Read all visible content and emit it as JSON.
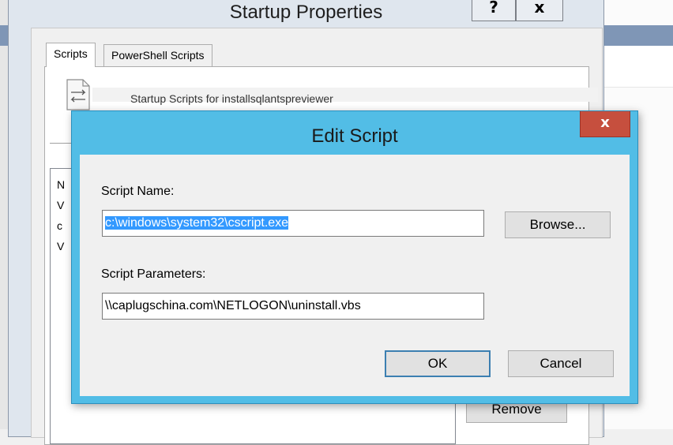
{
  "parent_window": {
    "title": "Startup Properties",
    "help_label": "?",
    "close_label": "x",
    "tabs": [
      {
        "label": "Scripts",
        "active": true
      },
      {
        "label": "PowerShell Scripts",
        "active": false
      }
    ],
    "description": "Startup Scripts for installsqlantspreviewer",
    "list_fragments": [
      "N",
      "V",
      "c",
      "V"
    ],
    "remove_label": "Remove"
  },
  "dialog": {
    "title": "Edit Script",
    "close_label": "x",
    "script_name_label": "Script Name:",
    "script_name_value": "c:\\windows\\system32\\cscript.exe",
    "browse_label": "Browse...",
    "script_params_label": "Script Parameters:",
    "script_params_value": "\\\\caplugschina.com\\NETLOGON\\uninstall.vbs",
    "ok_label": "OK",
    "cancel_label": "Cancel"
  },
  "colors": {
    "dialog_frame": "#52bde6",
    "close_button": "#c64f3e",
    "selection": "#3399ff"
  }
}
